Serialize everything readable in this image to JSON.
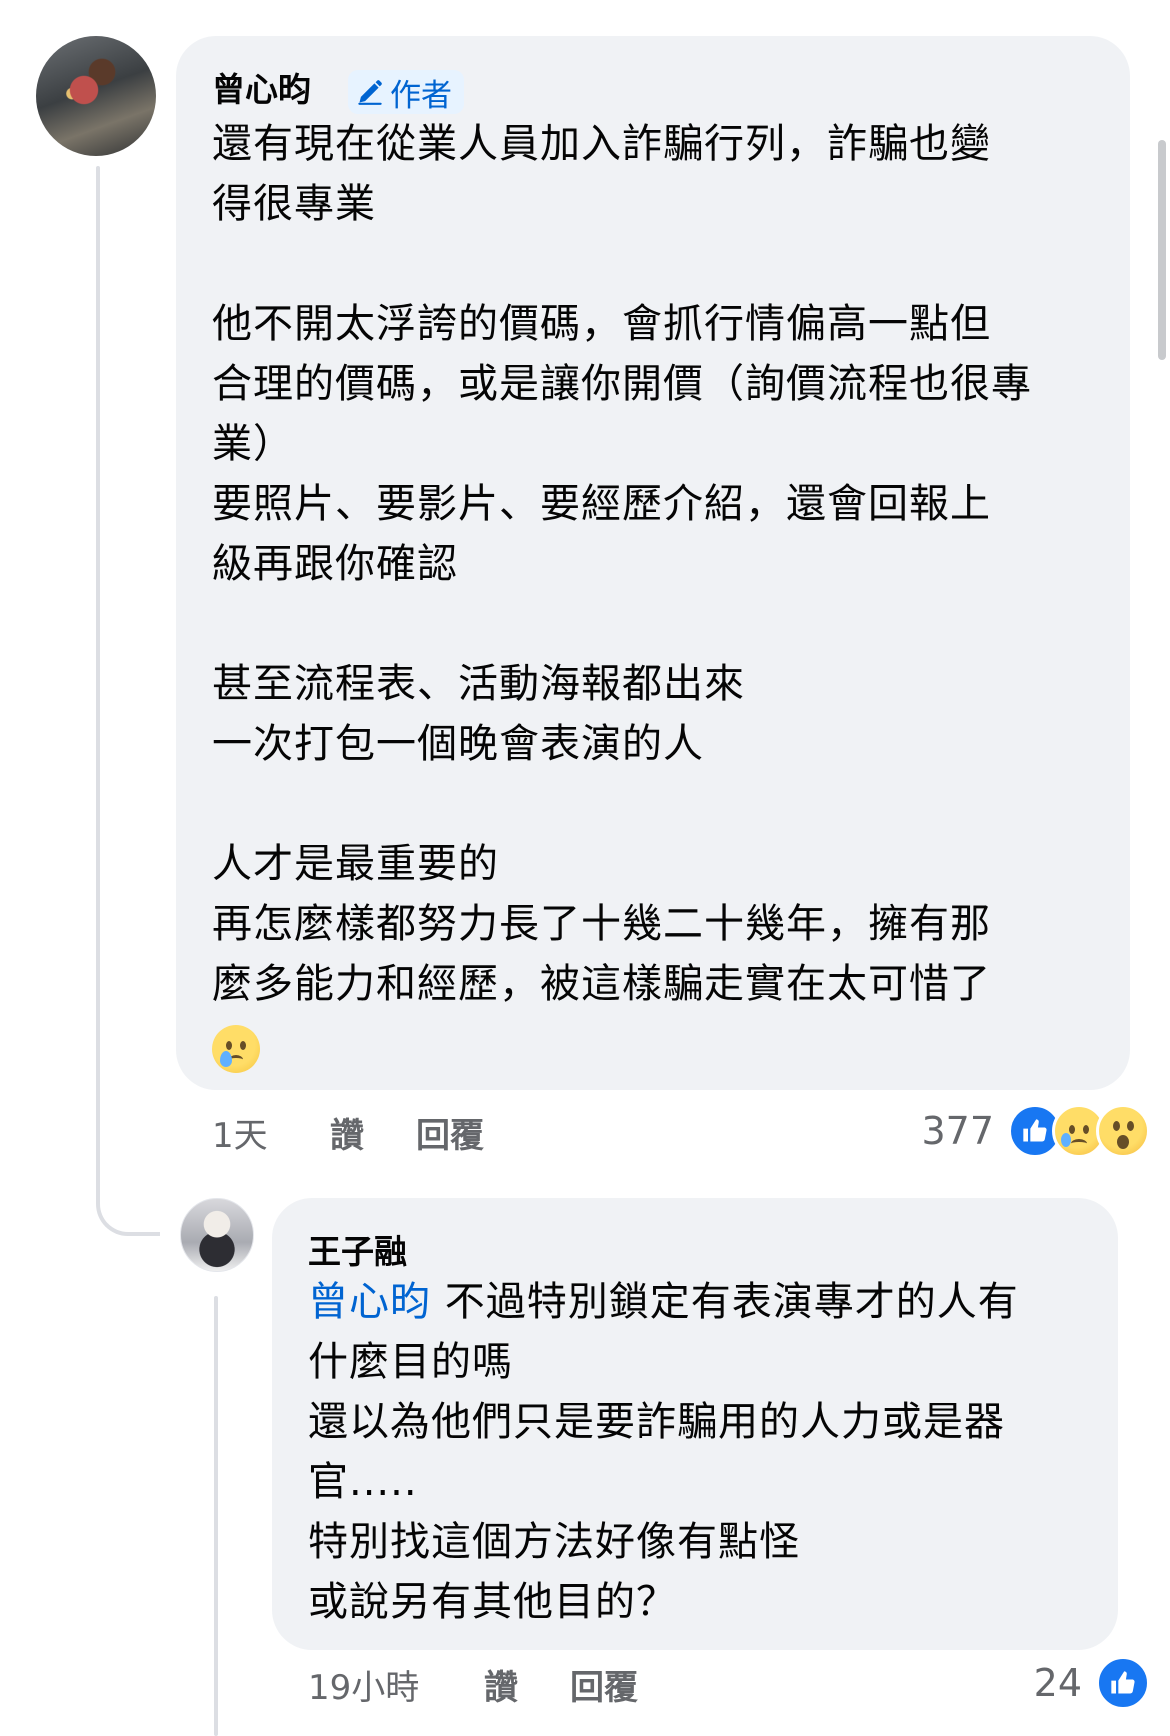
{
  "comment_1": {
    "author": "曾心昀",
    "badge_label": "作者",
    "body": "還有現在從業人員加入詐騙行列，詐騙也變\n得很專業\n\n他不開太浮誇的價碼，會抓行情偏高一點但\n合理的價碼，或是讓你開價（詢價流程也很專\n業）\n要照片、要影片、要經歷介紹，還會回報上\n級再跟你確認\n\n甚至流程表、活動海報都出來\n一次打包一個晚會表演的人\n\n人才是最重要的\n再怎麼樣都努力長了十幾二十幾年，擁有那\n麼多能力和經歷，被這樣騙走實在太可惜了",
    "emoji": "face-holding-back-tears",
    "time": "1天",
    "like_label": "讚",
    "reply_label": "回覆",
    "reaction_count": "377",
    "reaction_icons": [
      "like-icon",
      "sad-icon",
      "wow-icon"
    ]
  },
  "comment_2": {
    "author": "王子融",
    "mention": "曾心昀",
    "body_first": " 不過特別鎖定有表演專才的人有\n什麼目的嗎\n還以為他們只是要詐騙用的人力或是器\n官.....\n特別找這個方法好像有點怪\n或說另有其他目的？",
    "time": "19小時",
    "like_label": "讚",
    "reply_label": "回覆",
    "reaction_count": "24",
    "reaction_icons": [
      "like-icon"
    ]
  },
  "colors": {
    "bubble_bg": "#f0f2f5",
    "accent_blue": "#0064d1",
    "like_blue": "#1877f2",
    "meta_gray": "#65676b"
  }
}
